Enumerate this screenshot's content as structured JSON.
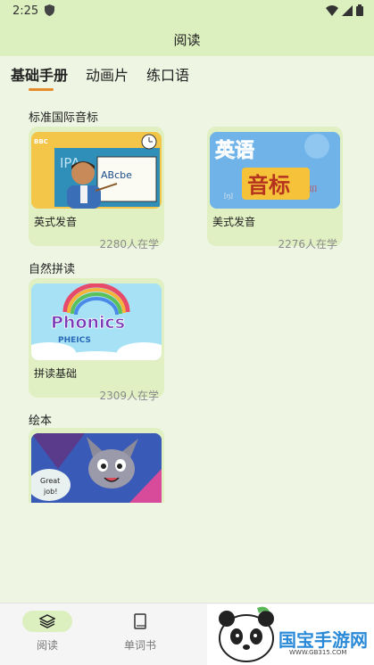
{
  "status_bar": {
    "time": "2:25"
  },
  "header": {
    "title": "阅读"
  },
  "tabs": [
    {
      "label": "基础手册",
      "active": true
    },
    {
      "label": "动画片",
      "active": false
    },
    {
      "label": "练口语",
      "active": false
    }
  ],
  "sections": [
    {
      "title": "标准国际音标",
      "cards": [
        {
          "title": "英式发音",
          "count": "2280人在学",
          "thumb_text": [
            "IPA",
            "ABcbe",
            "BBC"
          ]
        },
        {
          "title": "美式发音",
          "count": "2276人在学",
          "thumb_text": [
            "英语",
            "音标"
          ]
        }
      ]
    },
    {
      "title": "自然拼读",
      "cards": [
        {
          "title": "拼读基础",
          "count": "2309人在学",
          "thumb_text": [
            "Phonics",
            "PHEICS"
          ]
        }
      ]
    },
    {
      "title": "绘本",
      "cards": [
        {
          "title": "",
          "count": "",
          "thumb_text": [
            "Great",
            "job!"
          ]
        }
      ]
    }
  ],
  "bottom_nav": [
    {
      "label": "阅读",
      "icon": "layers-icon",
      "active": true
    },
    {
      "label": "单词书",
      "icon": "book-icon",
      "active": false
    }
  ],
  "watermark": {
    "brand": "国宝手游网",
    "url": "WWW.GB315.COM"
  },
  "colors": {
    "accent": "#e58b2a",
    "header_bg": "#dcefbf",
    "card_bg": "#e0f0c2",
    "page_bg": "#eef5e3"
  }
}
